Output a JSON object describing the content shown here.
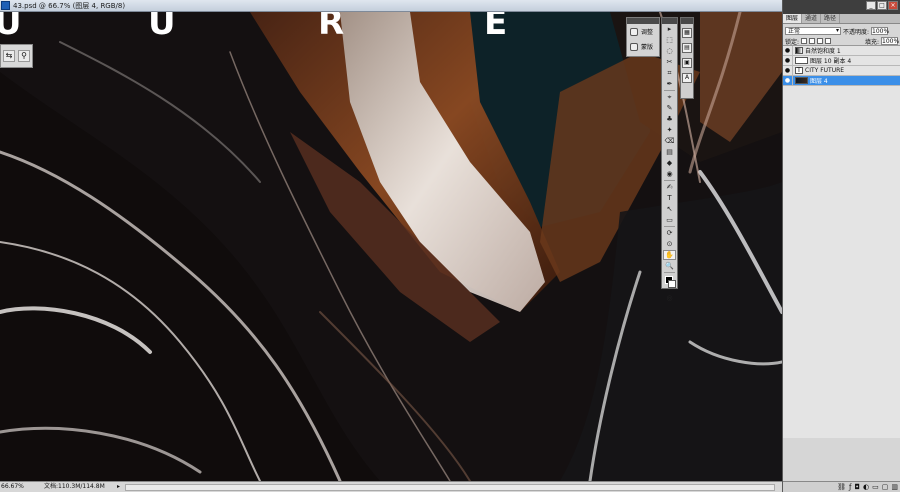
{
  "document": {
    "title": "43.psd @ 66.7% (图层 4, RGB/8)",
    "canvas_letters": [
      "U",
      "R",
      "E"
    ]
  },
  "mini_panel": {
    "items": [
      {
        "label": "调整",
        "icon": "adjustments-icon"
      },
      {
        "label": "蒙版",
        "icon": "masks-icon"
      }
    ]
  },
  "tools": [
    "▸",
    "⬚",
    "◌",
    "✂",
    "⌗",
    "✒",
    "⌖",
    "✎",
    "♣",
    "✦",
    "⌫",
    "▤",
    "◆",
    "◉",
    "✍",
    "T",
    "↖",
    "▭",
    "✋",
    "🔍"
  ],
  "layers_panel": {
    "tabs": [
      "图层",
      "通道",
      "路径"
    ],
    "blend_mode": "正常",
    "opacity_label": "不透明度:",
    "opacity_value": "100%",
    "lock_label": "锁定:",
    "fill_label": "填充:",
    "fill_value": "100%",
    "layers": [
      {
        "name": "自然饱和度 1",
        "thumb": "adj",
        "visible": true,
        "selected": false
      },
      {
        "name": "图层 10 副本 4",
        "thumb": "blank",
        "visible": true,
        "selected": false
      },
      {
        "name": "CITY FUTURE",
        "thumb": "txt",
        "visible": true,
        "selected": false
      },
      {
        "name": "图层 4",
        "thumb": "img",
        "visible": true,
        "selected": true
      }
    ],
    "bottom_icons": [
      "link-icon",
      "fx-icon",
      "mask-icon",
      "adjustment-icon",
      "folder-icon",
      "new-layer-icon",
      "trash-icon"
    ]
  },
  "status": {
    "zoom": "66.67%",
    "doc_info": "文档:110.3M/114.8M"
  }
}
